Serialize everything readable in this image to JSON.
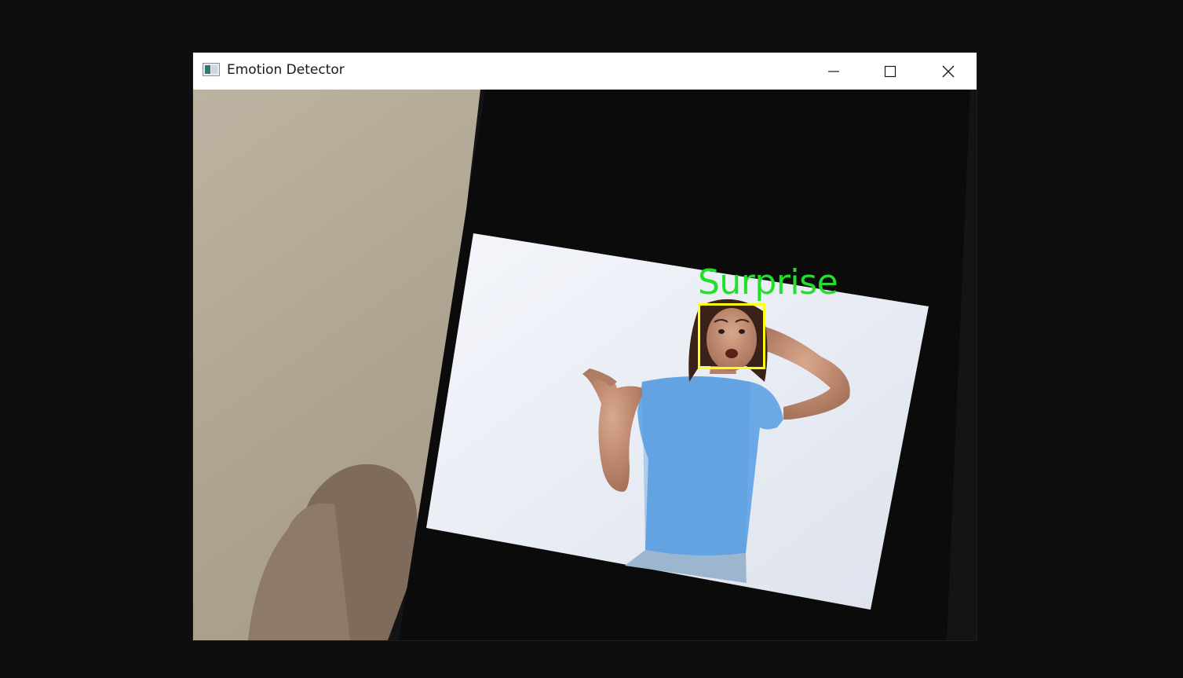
{
  "window": {
    "title": "Emotion Detector",
    "app_icon": "image-window-icon",
    "controls": [
      "minimize-icon",
      "maximize-icon",
      "close-icon"
    ]
  },
  "detection": {
    "label": "Surprise",
    "label_color": "#22e02a",
    "box_color": "#ffff14"
  }
}
